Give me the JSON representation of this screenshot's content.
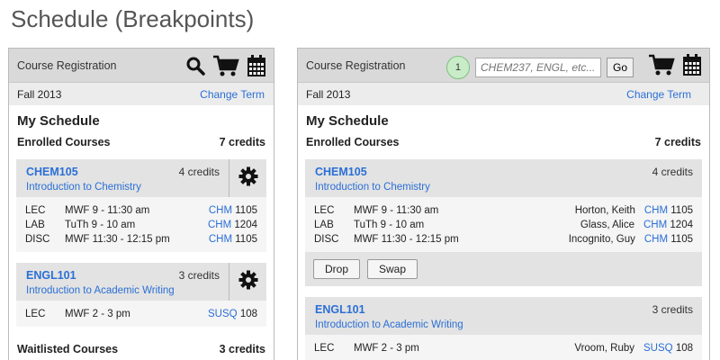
{
  "page": {
    "title": "Schedule (Breakpoints)"
  },
  "left": {
    "header_title": "Course Registration",
    "term": "Fall 2013",
    "change_term": "Change Term",
    "my_schedule": "My Schedule",
    "enrolled_label": "Enrolled Courses",
    "enrolled_credits": "7 credits",
    "courses": [
      {
        "code": "CHEM105",
        "credits": "4 credits",
        "name": "Introduction to Chemistry",
        "meetings": [
          {
            "type": "LEC",
            "time": "MWF 9 - 11:30 am",
            "bld": "CHM",
            "room": "1105"
          },
          {
            "type": "LAB",
            "time": "TuTh 9 - 10 am",
            "bld": "CHM",
            "room": "1204"
          },
          {
            "type": "DISC",
            "time": "MWF 11:30 - 12:15 pm",
            "bld": "CHM",
            "room": "1105"
          }
        ]
      },
      {
        "code": "ENGL101",
        "credits": "3 credits",
        "name": "Introduction to Academic Writing",
        "meetings": [
          {
            "type": "LEC",
            "time": "MWF 2 - 3 pm",
            "bld": "SUSQ",
            "room": "108"
          }
        ]
      }
    ],
    "waitlisted_label": "Waitlisted Courses",
    "waitlisted_credits": "3 credits"
  },
  "right": {
    "header_title": "Course Registration",
    "badge": "1",
    "search_placeholder": "CHEM237, ENGL, etc...",
    "go_label": "Go",
    "term": "Fall 2013",
    "change_term": "Change Term",
    "my_schedule": "My Schedule",
    "enrolled_label": "Enrolled Courses",
    "enrolled_credits": "7 credits",
    "courses": [
      {
        "code": "CHEM105",
        "credits": "4 credits",
        "name": "Introduction to Chemistry",
        "meetings": [
          {
            "type": "LEC",
            "time": "MWF 9 - 11:30 am",
            "instructor": "Horton, Keith",
            "bld": "CHM",
            "room": "1105"
          },
          {
            "type": "LAB",
            "time": "TuTh 9 - 10 am",
            "instructor": "Glass, Alice",
            "bld": "CHM",
            "room": "1204"
          },
          {
            "type": "DISC",
            "time": "MWF 11:30 - 12:15 pm",
            "instructor": "Incognito, Guy",
            "bld": "CHM",
            "room": "1105"
          }
        ],
        "drop": "Drop",
        "swap": "Swap"
      },
      {
        "code": "ENGL101",
        "credits": "3 credits",
        "name": "Introduction to Academic Writing",
        "meetings": [
          {
            "type": "LEC",
            "time": "MWF 2 - 3 pm",
            "instructor": "Vroom, Ruby",
            "bld": "SUSQ",
            "room": "108"
          }
        ]
      }
    ]
  },
  "icons": {
    "search": "search-icon",
    "cart": "cart-icon",
    "calendar": "calendar-icon",
    "gear": "gear-icon"
  }
}
